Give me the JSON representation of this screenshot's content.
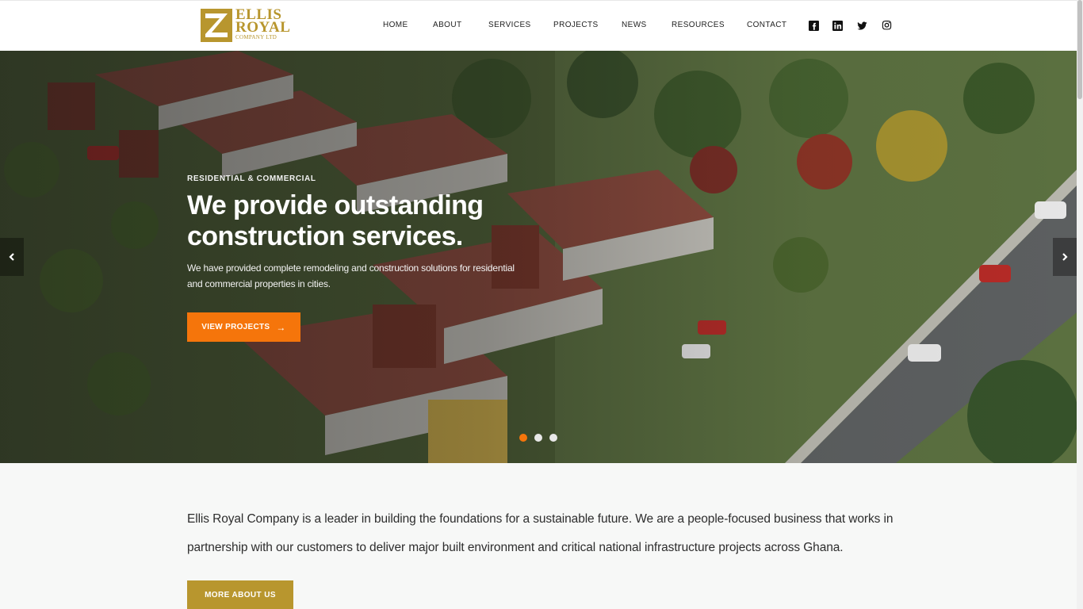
{
  "logo": {
    "line1": "ELLIS",
    "line2": "ROYAL",
    "line3": "COMPANY LTD",
    "color": "#b8962e"
  },
  "nav": {
    "items": [
      {
        "label": "HOME"
      },
      {
        "label": "ABOUT"
      },
      {
        "label": "SERVICES"
      },
      {
        "label": "PROJECTS"
      },
      {
        "label": "NEWS"
      },
      {
        "label": "RESOURCES"
      },
      {
        "label": "CONTACT"
      }
    ]
  },
  "social": {
    "icons": [
      "facebook-icon",
      "linkedin-icon",
      "twitter-icon",
      "instagram-icon"
    ]
  },
  "hero": {
    "kicker": "RESIDENTIAL & COMMERCIAL",
    "title": "We provide outstanding construction services.",
    "subtitle": "We have provided complete remodeling and construction solutions for residential and commercial properties in cities.",
    "button_label": "VIEW PROJECTS",
    "button_icon": "arrow-right-icon",
    "slides_total": 3,
    "active_slide": 1,
    "accent": "#f5750b"
  },
  "about": {
    "text": "Ellis Royal Company is a leader in building the foundations for a sustainable future. We are a people-focused business that works in partnership with our customers to deliver major built environment and critical national infrastructure projects across Ghana.",
    "button_label": "MORE ABOUT US",
    "button_color": "#b8962e"
  }
}
